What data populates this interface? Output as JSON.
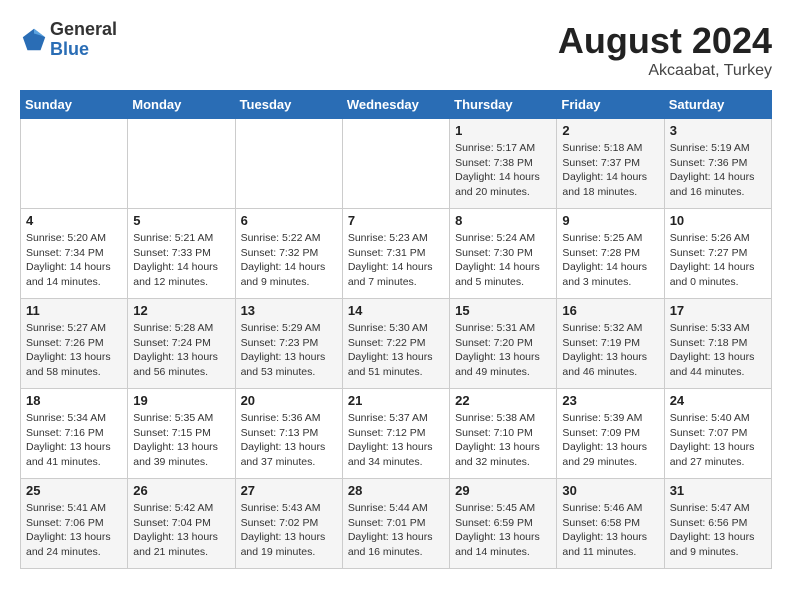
{
  "header": {
    "logo_general": "General",
    "logo_blue": "Blue",
    "month_year": "August 2024",
    "location": "Akcaabat, Turkey"
  },
  "weekdays": [
    "Sunday",
    "Monday",
    "Tuesday",
    "Wednesday",
    "Thursday",
    "Friday",
    "Saturday"
  ],
  "weeks": [
    [
      {
        "day": "",
        "info": ""
      },
      {
        "day": "",
        "info": ""
      },
      {
        "day": "",
        "info": ""
      },
      {
        "day": "",
        "info": ""
      },
      {
        "day": "1",
        "info": "Sunrise: 5:17 AM\nSunset: 7:38 PM\nDaylight: 14 hours\nand 20 minutes."
      },
      {
        "day": "2",
        "info": "Sunrise: 5:18 AM\nSunset: 7:37 PM\nDaylight: 14 hours\nand 18 minutes."
      },
      {
        "day": "3",
        "info": "Sunrise: 5:19 AM\nSunset: 7:36 PM\nDaylight: 14 hours\nand 16 minutes."
      }
    ],
    [
      {
        "day": "4",
        "info": "Sunrise: 5:20 AM\nSunset: 7:34 PM\nDaylight: 14 hours\nand 14 minutes."
      },
      {
        "day": "5",
        "info": "Sunrise: 5:21 AM\nSunset: 7:33 PM\nDaylight: 14 hours\nand 12 minutes."
      },
      {
        "day": "6",
        "info": "Sunrise: 5:22 AM\nSunset: 7:32 PM\nDaylight: 14 hours\nand 9 minutes."
      },
      {
        "day": "7",
        "info": "Sunrise: 5:23 AM\nSunset: 7:31 PM\nDaylight: 14 hours\nand 7 minutes."
      },
      {
        "day": "8",
        "info": "Sunrise: 5:24 AM\nSunset: 7:30 PM\nDaylight: 14 hours\nand 5 minutes."
      },
      {
        "day": "9",
        "info": "Sunrise: 5:25 AM\nSunset: 7:28 PM\nDaylight: 14 hours\nand 3 minutes."
      },
      {
        "day": "10",
        "info": "Sunrise: 5:26 AM\nSunset: 7:27 PM\nDaylight: 14 hours\nand 0 minutes."
      }
    ],
    [
      {
        "day": "11",
        "info": "Sunrise: 5:27 AM\nSunset: 7:26 PM\nDaylight: 13 hours\nand 58 minutes."
      },
      {
        "day": "12",
        "info": "Sunrise: 5:28 AM\nSunset: 7:24 PM\nDaylight: 13 hours\nand 56 minutes."
      },
      {
        "day": "13",
        "info": "Sunrise: 5:29 AM\nSunset: 7:23 PM\nDaylight: 13 hours\nand 53 minutes."
      },
      {
        "day": "14",
        "info": "Sunrise: 5:30 AM\nSunset: 7:22 PM\nDaylight: 13 hours\nand 51 minutes."
      },
      {
        "day": "15",
        "info": "Sunrise: 5:31 AM\nSunset: 7:20 PM\nDaylight: 13 hours\nand 49 minutes."
      },
      {
        "day": "16",
        "info": "Sunrise: 5:32 AM\nSunset: 7:19 PM\nDaylight: 13 hours\nand 46 minutes."
      },
      {
        "day": "17",
        "info": "Sunrise: 5:33 AM\nSunset: 7:18 PM\nDaylight: 13 hours\nand 44 minutes."
      }
    ],
    [
      {
        "day": "18",
        "info": "Sunrise: 5:34 AM\nSunset: 7:16 PM\nDaylight: 13 hours\nand 41 minutes."
      },
      {
        "day": "19",
        "info": "Sunrise: 5:35 AM\nSunset: 7:15 PM\nDaylight: 13 hours\nand 39 minutes."
      },
      {
        "day": "20",
        "info": "Sunrise: 5:36 AM\nSunset: 7:13 PM\nDaylight: 13 hours\nand 37 minutes."
      },
      {
        "day": "21",
        "info": "Sunrise: 5:37 AM\nSunset: 7:12 PM\nDaylight: 13 hours\nand 34 minutes."
      },
      {
        "day": "22",
        "info": "Sunrise: 5:38 AM\nSunset: 7:10 PM\nDaylight: 13 hours\nand 32 minutes."
      },
      {
        "day": "23",
        "info": "Sunrise: 5:39 AM\nSunset: 7:09 PM\nDaylight: 13 hours\nand 29 minutes."
      },
      {
        "day": "24",
        "info": "Sunrise: 5:40 AM\nSunset: 7:07 PM\nDaylight: 13 hours\nand 27 minutes."
      }
    ],
    [
      {
        "day": "25",
        "info": "Sunrise: 5:41 AM\nSunset: 7:06 PM\nDaylight: 13 hours\nand 24 minutes."
      },
      {
        "day": "26",
        "info": "Sunrise: 5:42 AM\nSunset: 7:04 PM\nDaylight: 13 hours\nand 21 minutes."
      },
      {
        "day": "27",
        "info": "Sunrise: 5:43 AM\nSunset: 7:02 PM\nDaylight: 13 hours\nand 19 minutes."
      },
      {
        "day": "28",
        "info": "Sunrise: 5:44 AM\nSunset: 7:01 PM\nDaylight: 13 hours\nand 16 minutes."
      },
      {
        "day": "29",
        "info": "Sunrise: 5:45 AM\nSunset: 6:59 PM\nDaylight: 13 hours\nand 14 minutes."
      },
      {
        "day": "30",
        "info": "Sunrise: 5:46 AM\nSunset: 6:58 PM\nDaylight: 13 hours\nand 11 minutes."
      },
      {
        "day": "31",
        "info": "Sunrise: 5:47 AM\nSunset: 6:56 PM\nDaylight: 13 hours\nand 9 minutes."
      }
    ]
  ]
}
